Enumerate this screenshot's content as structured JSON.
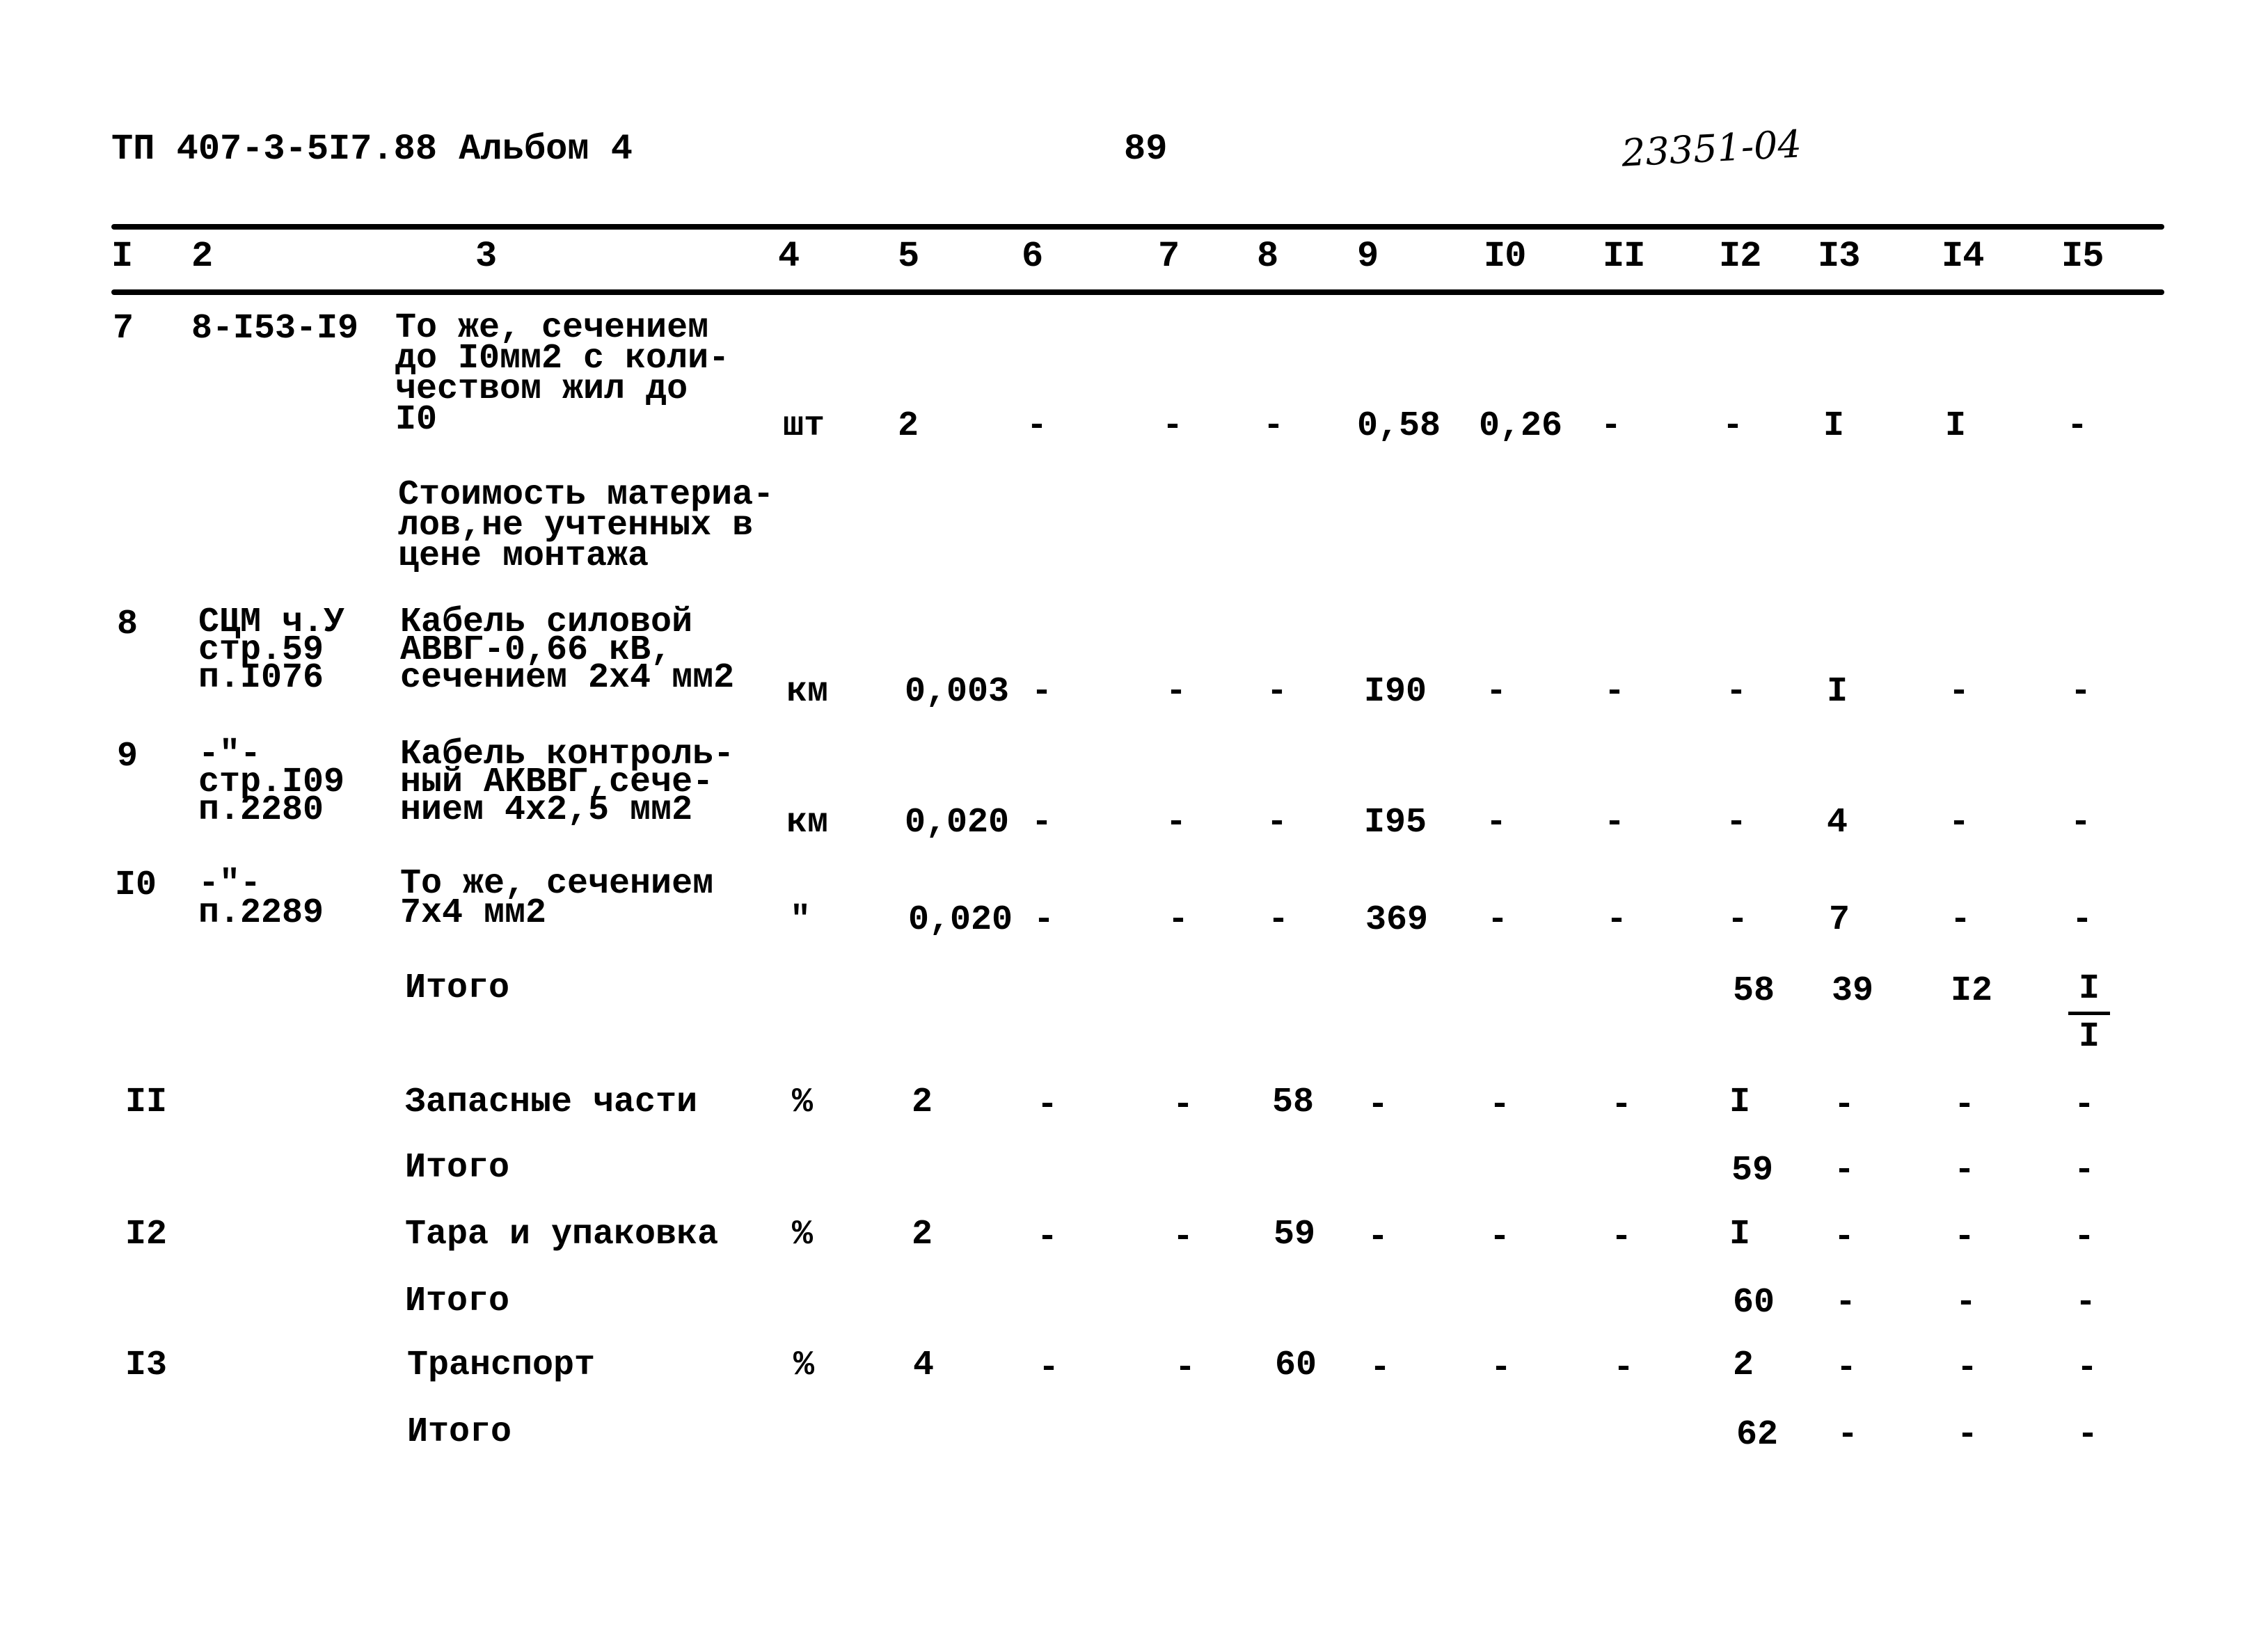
{
  "header": {
    "doc_title": "ТП 407-3-5I7.88 Альбом 4",
    "page_number": "89",
    "stamp": "23351-04"
  },
  "columns": [
    "I",
    "2",
    "3",
    "4",
    "5",
    "6",
    "7",
    "8",
    "9",
    "I0",
    "II",
    "I2",
    "I3",
    "I4",
    "I5"
  ],
  "rows": [
    {
      "no": "7",
      "ref": "8-I53-I9",
      "desc": "То же, сечением\nдо I0мм2 с коли-\nчеством жил до\nI0",
      "unit": "шт",
      "c5": "2",
      "c6": "-",
      "c7": "-",
      "c8": "-",
      "c9": "0,58",
      "c10": "0,26",
      "c11": "-",
      "c12": "-",
      "c13": "I",
      "c14": "I",
      "c15": "-"
    },
    {
      "no": "",
      "ref": "",
      "desc": "Стоимость материа-\nлов,не учтенных в\nцене монтажа",
      "unit": "",
      "c5": "",
      "c6": "",
      "c7": "",
      "c8": "",
      "c9": "",
      "c10": "",
      "c11": "",
      "c12": "",
      "c13": "",
      "c14": "",
      "c15": ""
    },
    {
      "no": "8",
      "ref": "СЦМ ч.У\nстр.59\nп.I076",
      "desc": "Кабель силовой\nАВВГ-0,66 кВ,\nсечением 2х4 мм2",
      "unit": "км",
      "c5": "0,003",
      "c6": "-",
      "c7": "-",
      "c8": "-",
      "c9": "I90",
      "c10": "-",
      "c11": "-",
      "c12": "-",
      "c13": "I",
      "c14": "-",
      "c15": "-"
    },
    {
      "no": "9",
      "ref": "-\"-\nстр.I09\nп.2280",
      "desc": "Кабель контроль-\nный АКВВГ,сече-\nнием 4х2,5 мм2",
      "unit": "км",
      "c5": "0,020",
      "c6": "-",
      "c7": "-",
      "c8": "-",
      "c9": "I95",
      "c10": "-",
      "c11": "-",
      "c12": "-",
      "c13": "4",
      "c14": "-",
      "c15": "-"
    },
    {
      "no": "I0",
      "ref": "-\"-\nп.2289",
      "desc": "То же, сечением\n7х4 мм2",
      "unit": "\"",
      "c5": "0,020",
      "c6": "-",
      "c7": "-",
      "c8": "-",
      "c9": "369",
      "c10": "-",
      "c11": "-",
      "c12": "-",
      "c13": "7",
      "c14": "-",
      "c15": "-"
    },
    {
      "no": "",
      "ref": "",
      "desc": "Итого",
      "unit": "",
      "c5": "",
      "c6": "",
      "c7": "",
      "c8": "",
      "c9": "",
      "c10": "",
      "c11": "",
      "c12": "58",
      "c13": "39",
      "c14": "I2",
      "c15_num": "I",
      "c15_den": "I"
    },
    {
      "no": "II",
      "ref": "",
      "desc": "Запасные части",
      "unit": "%",
      "c5": "2",
      "c6": "-",
      "c7": "-",
      "c8": "58",
      "c9": "-",
      "c10": "-",
      "c11": "-",
      "c12": "I",
      "c13": "-",
      "c14": "-",
      "c15": "-"
    },
    {
      "no": "",
      "ref": "",
      "desc": "Итого",
      "unit": "",
      "c5": "",
      "c6": "",
      "c7": "",
      "c8": "",
      "c9": "",
      "c10": "",
      "c11": "",
      "c12": "59",
      "c13": "-",
      "c14": "-",
      "c15": "-"
    },
    {
      "no": "I2",
      "ref": "",
      "desc": "Тара и упаковка",
      "unit": "%",
      "c5": "2",
      "c6": "-",
      "c7": "-",
      "c8": "59",
      "c9": "-",
      "c10": "-",
      "c11": "-",
      "c12": "I",
      "c13": "-",
      "c14": "-",
      "c15": "-"
    },
    {
      "no": "",
      "ref": "",
      "desc": "Итого",
      "unit": "",
      "c5": "",
      "c6": "",
      "c7": "",
      "c8": "",
      "c9": "",
      "c10": "",
      "c11": "",
      "c12": "60",
      "c13": "-",
      "c14": "-",
      "c15": "-"
    },
    {
      "no": "I3",
      "ref": "",
      "desc": "Транспорт",
      "unit": "%",
      "c5": "4",
      "c6": "-",
      "c7": "-",
      "c8": "60",
      "c9": "-",
      "c10": "-",
      "c11": "-",
      "c12": "2",
      "c13": "-",
      "c14": "-",
      "c15": "-"
    },
    {
      "no": "",
      "ref": "",
      "desc": "Итого",
      "unit": "",
      "c5": "",
      "c6": "",
      "c7": "",
      "c8": "",
      "c9": "",
      "c10": "",
      "c11": "",
      "c12": "62",
      "c13": "-",
      "c14": "-",
      "c15": "-"
    }
  ]
}
